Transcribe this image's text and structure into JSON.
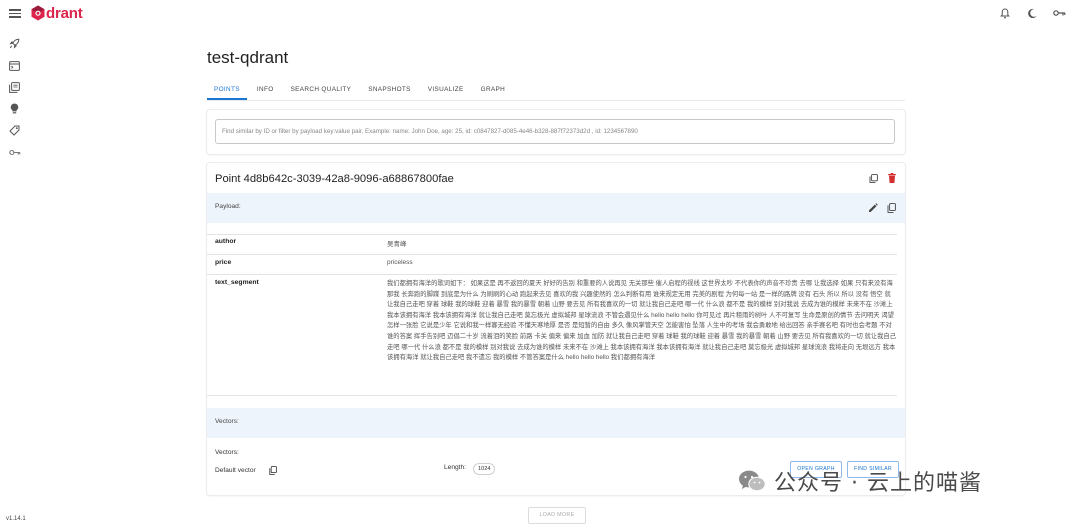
{
  "app": {
    "logo_text": "drant",
    "version": "v1.14.1"
  },
  "header": {
    "icons": [
      "bell-icon",
      "moon-icon",
      "key-icon"
    ]
  },
  "sidebar": {
    "icons": [
      "rocket-icon",
      "console-icon",
      "collections-icon",
      "lightbulb-icon",
      "datasets-icon",
      "key-icon"
    ]
  },
  "collection": {
    "title": "test-qdrant"
  },
  "tabs": [
    {
      "label": "POINTS",
      "active": true
    },
    {
      "label": "INFO",
      "active": false
    },
    {
      "label": "SEARCH QUALITY",
      "active": false
    },
    {
      "label": "SNAPSHOTS",
      "active": false
    },
    {
      "label": "VISUALIZE",
      "active": false
    },
    {
      "label": "GRAPH",
      "active": false
    }
  ],
  "search": {
    "placeholder": "Find similar by ID or filter by payload key:value pair. Example: name: John Doe, age: 25, id: c0847827-d085-4e46-b328-887f72373d2d , id: 1234567890"
  },
  "point": {
    "title": "Point 4d8b642c-3039-42a8-9096-a68867800fae",
    "payload_label": "Payload:",
    "payload": [
      {
        "key": "author",
        "value": "吴青峰"
      },
      {
        "key": "price",
        "value": "priceless"
      },
      {
        "key": "text_segment",
        "value": "我们都拥有海洋的歌词如下： 如果这是 再不返回的夏天 好好的告别 和重要的人说再见 无关那些 催人启程的视线 这世界太吵 不代表你的声音不珍贵 去哪 让我选择 如果 只有来没有海 那我 长奔跑的脚蹀 到底是为什么 为刷刷的心动 跑起来去见 喜欢的我 兴趣使然的 怎么判断有用 谁来规定无用 完美的剧程 为何每一站 是一样的路牌 没有 石头 所以 所以 没有 悟空 就让我自己走吧 穿着 球鞋 我的球鞋 迎着 暴雪 我的暴雪 朝着 山野 要去见 所有我喜欢的一切 就让我自己走吧 哪一代 什么浪 都不是 我的模样 别对我说 去成为谁的模样 未来不在 沙滩上 我本该拥有海洋 我本该拥有海洋 就让我自己走吧 莫忘极光 虚拟城邦 星球流浪 不管会遇见什么 hello hello hello 你可见过 再片租雨的树叶 人不可复写 生命是原创的情节 去问明天 渴望怎样一张脸 它说是少年 它说和我一样寡无经验 不懂天寒地厚 是否 是短暂的自由 多久 像风掌管天空 怎能害怕 坠落 人生中的考场 我会勇敢地 给出回答 亲手赛名吧 有时也会考题 不对谁的答案 挥手告别吧 迈倡二十岁 流着泪的笑脸 前路 卡关 偏来 偏来 加血 加防 就让我自己走吧 穿着 球鞋 我的球鞋 迎着 暴雪 我的暴雪 朝着 山野 要去见 所有我喜欢的一切 就让我自己走吧 哪一代 什么浪 都不是 我的模样 别对我说 去成为谁的模样 未来不在 沙滩上 我本该拥有海洋 我本该拥有海洋 就让我自己走吧 莫忘极光 虚拟城邦 星球流浪 我将走向 无垠远方 我本该拥有海洋 就让我自己走吧 我不遗忘 我的模样 不管答案是什么 hello hello hello 我们都拥有海洋"
      }
    ],
    "vectors_label": "Vectors:",
    "vectors_sub_label": "Vectors:",
    "vector_name": "Default vector",
    "length_label": "Length:",
    "length_value": "1024",
    "open_graph_label": "OPEN GRAPH",
    "find_similar_label": "FIND SIMILAR"
  },
  "load_more_label": "LOAD MORE",
  "watermark": {
    "text": "公众号 · 云上的喵酱"
  },
  "colors": {
    "accent": "#1976d2",
    "brand": "#dc244c",
    "delete": "#d32f2f",
    "section_bg": "#eef4fb"
  }
}
